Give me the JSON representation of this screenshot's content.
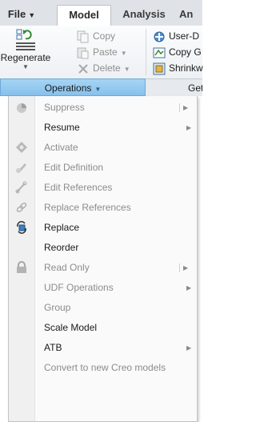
{
  "tabs": {
    "file": "File",
    "model": "Model",
    "analysis": "Analysis",
    "truncated": "An"
  },
  "ribbon": {
    "regenerate": "Regenerate",
    "copy": "Copy",
    "paste": "Paste",
    "delete": "Delete",
    "user_defined": "User-D",
    "copy_geometry": "Copy G",
    "shrinkwrap": "Shrinkw"
  },
  "groups": {
    "operations": "Operations",
    "get": "Get"
  },
  "menu": {
    "items": [
      {
        "label": "Suppress",
        "icon": "suppress-icon",
        "disabled": true,
        "submenu": true
      },
      {
        "label": "Resume",
        "icon": "",
        "disabled": false,
        "submenu": true
      },
      {
        "label": "Activate",
        "icon": "activate-icon",
        "disabled": true,
        "submenu": false
      },
      {
        "label": "Edit Definition",
        "icon": "edit-definition-icon",
        "disabled": true,
        "submenu": false
      },
      {
        "label": "Edit References",
        "icon": "edit-references-icon",
        "disabled": true,
        "submenu": false
      },
      {
        "label": "Replace References",
        "icon": "replace-references-icon",
        "disabled": true,
        "submenu": false
      },
      {
        "label": "Replace",
        "icon": "replace-icon",
        "disabled": false,
        "submenu": false
      },
      {
        "label": "Reorder",
        "icon": "",
        "disabled": false,
        "submenu": false
      },
      {
        "label": "Read Only",
        "icon": "lock-icon",
        "disabled": true,
        "submenu": true
      },
      {
        "label": "UDF Operations",
        "icon": "",
        "disabled": true,
        "submenu": true
      },
      {
        "label": "Group",
        "icon": "",
        "disabled": true,
        "submenu": false
      },
      {
        "label": "Scale Model",
        "icon": "",
        "disabled": false,
        "submenu": false
      },
      {
        "label": "ATB",
        "icon": "",
        "disabled": false,
        "submenu": true
      },
      {
        "label": "Convert to new Creo models",
        "icon": "",
        "disabled": true,
        "submenu": false
      }
    ]
  },
  "colors": {
    "active_group": "#9ccdf2",
    "disabled_text": "#8c8c8c",
    "text": "#1a1a1a"
  }
}
